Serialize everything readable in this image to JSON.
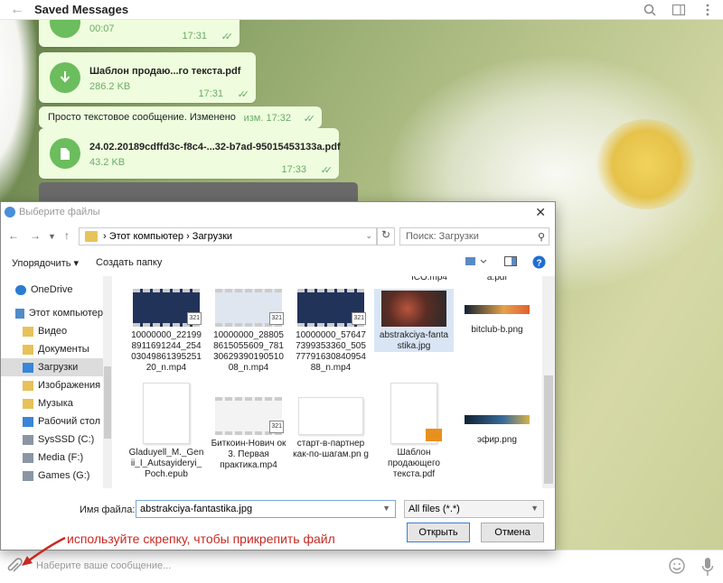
{
  "header": {
    "title": "Saved Messages"
  },
  "messages": [
    {
      "type": "audio",
      "size": "00:07",
      "time": "17:31"
    },
    {
      "type": "file",
      "name": "Шаблон продаю...го текста.pdf",
      "size": "286.2 KB",
      "time": "17:31"
    },
    {
      "type": "text",
      "text": "Просто текстовое сообщение. Изменено",
      "time": "изм. 17:32"
    },
    {
      "type": "file",
      "name": "24.02.20189cdffd3c-f8c4-...32-b7ad-95015453133a.pdf",
      "size": "43.2 KB",
      "time": "17:33"
    }
  ],
  "dialog": {
    "title": "Выберите файлы",
    "address": [
      "Этот компьютер",
      "Загрузки"
    ],
    "search_placeholder": "Поиск: Загрузки",
    "toolbar": {
      "organize": "Упорядочить",
      "new_folder": "Создать папку"
    },
    "sidebar": [
      {
        "label": "OneDrive",
        "icon": "cloud-icon"
      },
      {
        "label": "Этот компьютер",
        "icon": "computer-icon"
      },
      {
        "label": "Видео",
        "icon": "video-folder-icon"
      },
      {
        "label": "Документы",
        "icon": "documents-folder-icon"
      },
      {
        "label": "Загрузки",
        "icon": "downloads-folder-icon",
        "selected": true
      },
      {
        "label": "Изображения",
        "icon": "images-folder-icon"
      },
      {
        "label": "Музыка",
        "icon": "music-folder-icon"
      },
      {
        "label": "Рабочий стол",
        "icon": "desktop-folder-icon"
      },
      {
        "label": "SysSSD (C:)",
        "icon": "drive-icon"
      },
      {
        "label": "Media (F:)",
        "icon": "drive-icon"
      },
      {
        "label": "Games (G:)",
        "icon": "drive-icon"
      }
    ],
    "files_top": [
      "ICO.mp4",
      "a.pdf"
    ],
    "files": [
      {
        "name": "10000000_22199 8911691244_254 03049861395251 20_n.mp4",
        "kind": "video"
      },
      {
        "name": "10000000_28805 8615055609_781 30629390190510 08_n.mp4",
        "kind": "video"
      },
      {
        "name": "10000000_57647 7399353360_505 77791630840954 88_n.mp4",
        "kind": "video"
      },
      {
        "name": "abstrakciya-fanta stika.jpg",
        "kind": "image",
        "selected": true
      },
      {
        "name": "bitclub-b.png",
        "kind": "strip"
      },
      {
        "name": "Gladuyell_M._Gen ii_I_Autsayideryi_ Poch.epub",
        "kind": "doc"
      },
      {
        "name": "Биткоин-Нович ок 3. Первая практика.mp4",
        "kind": "video"
      },
      {
        "name": "старт-в-партнер как-по-шагам.pn g",
        "kind": "doc"
      },
      {
        "name": "Шаблон продающего текста.pdf",
        "kind": "pdf"
      },
      {
        "name": "эфир.png",
        "kind": "strip"
      }
    ],
    "video_badge": "321",
    "filename_label": "Имя файла:",
    "filename_value": "abstrakciya-fantastika.jpg",
    "filetype": "All files (*.*)",
    "open_label": "Открыть",
    "cancel_label": "Отмена"
  },
  "hint": "используйте скрепку, чтобы прикрепить файл",
  "composer": {
    "placeholder": "Наберите ваше сообщение..."
  },
  "colors": {
    "bubble": "#effdde",
    "accent": "#6bbd5d",
    "hint": "#c62a23"
  }
}
